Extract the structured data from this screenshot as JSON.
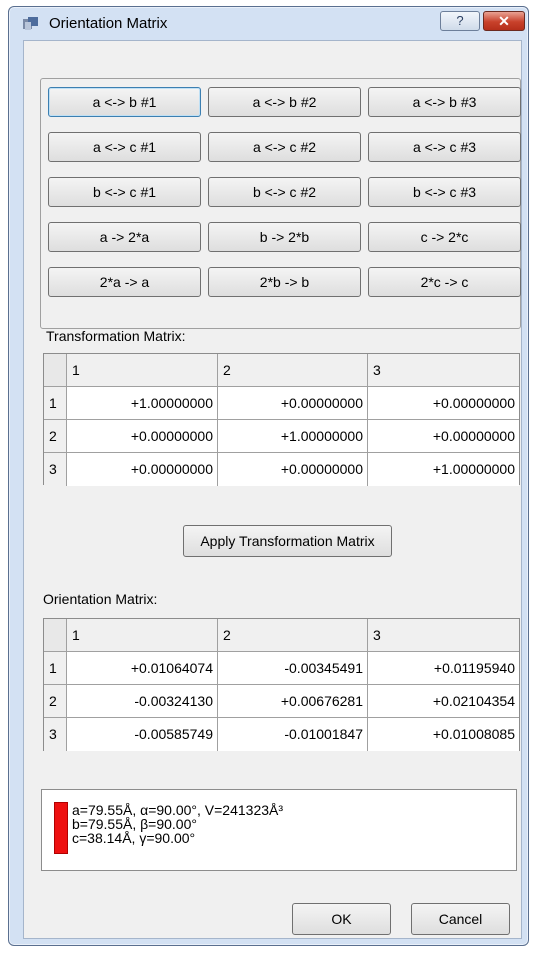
{
  "window": {
    "title": "Orientation Matrix",
    "help_label": "?",
    "close_label": "✕"
  },
  "swap_buttons": [
    [
      "a <-> b #1",
      "a <-> b #2",
      "a <-> b #3"
    ],
    [
      "a <-> c #1",
      "a <-> c #2",
      "a <-> c #3"
    ],
    [
      "b <-> c #1",
      "b <-> c #2",
      "b <-> c #3"
    ],
    [
      "a -> 2*a",
      "b -> 2*b",
      "c -> 2*c"
    ],
    [
      "2*a -> a",
      "2*b -> b",
      "2*c -> c"
    ]
  ],
  "transformation": {
    "label": "Transformation Matrix:",
    "columns": [
      "1",
      "2",
      "3"
    ],
    "rows": [
      {
        "header": "1",
        "values": [
          "+1.00000000",
          "+0.00000000",
          "+0.00000000"
        ]
      },
      {
        "header": "2",
        "values": [
          "+0.00000000",
          "+1.00000000",
          "+0.00000000"
        ]
      },
      {
        "header": "3",
        "values": [
          "+0.00000000",
          "+0.00000000",
          "+1.00000000"
        ]
      }
    ]
  },
  "apply_button_label": "Apply Transformation Matrix",
  "orientation": {
    "label": "Orientation Matrix:",
    "columns": [
      "1",
      "2",
      "3"
    ],
    "rows": [
      {
        "header": "1",
        "values": [
          "+0.01064074",
          "-0.00345491",
          "+0.01195940"
        ]
      },
      {
        "header": "2",
        "values": [
          "-0.00324130",
          "+0.00676281",
          "+0.02104354"
        ]
      },
      {
        "header": "3",
        "values": [
          "-0.00585749",
          "-0.01001847",
          "+0.01008085"
        ]
      }
    ]
  },
  "cell_info": {
    "swatch_color": "#ee1010",
    "lines": [
      "a=79.55Å,  α=90.00°,  V=241323Å³",
      "b=79.55Å,  β=90.00°",
      "c=38.14Å,  γ=90.00°"
    ]
  },
  "footer": {
    "ok_label": "OK",
    "cancel_label": "Cancel"
  }
}
